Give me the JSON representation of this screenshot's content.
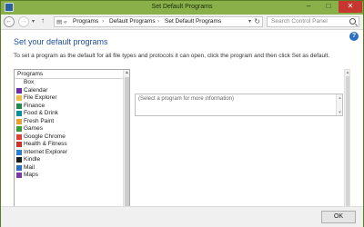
{
  "window": {
    "title": "Set Default Programs",
    "accent": "#8ab04a",
    "close_color": "#c7372f"
  },
  "window_buttons": {
    "minimize": "–",
    "maximize": "□",
    "close": "✕"
  },
  "nav": {
    "back_icon": "back-arrow-icon",
    "forward_icon": "forward-arrow-icon",
    "recent_icon": "chevron-down-icon",
    "up_icon": "up-arrow-icon",
    "breadcrumbs": [
      "Programs",
      "Default Programs",
      "Set Default Programs"
    ],
    "search_placeholder": "Search Control Panel"
  },
  "main": {
    "heading": "Set your default programs",
    "description": "To set a program as the default for all file types and protocols it can open, click the program and then click Set as default.",
    "list_header": "Programs",
    "programs": [
      {
        "label": "Box",
        "color": "#ffffff"
      },
      {
        "label": "Calendar",
        "color": "#6b2fa0"
      },
      {
        "label": "File Explorer",
        "color": "#e9c14c"
      },
      {
        "label": "Finance",
        "color": "#1f8a4c"
      },
      {
        "label": "Food & Drink",
        "color": "#0a8ea0"
      },
      {
        "label": "Fresh Paint",
        "color": "#e8a030"
      },
      {
        "label": "Games",
        "color": "#3a9a3a"
      },
      {
        "label": "Google Chrome",
        "color": "#d9443a"
      },
      {
        "label": "Health & Fitness",
        "color": "#c8342a"
      },
      {
        "label": "Internet Explorer",
        "color": "#2a7fd0"
      },
      {
        "label": "Kindle",
        "color": "#1a1a1a"
      },
      {
        "label": "Mail",
        "color": "#2a6fbf"
      },
      {
        "label": "Maps",
        "color": "#7a3aa0"
      }
    ],
    "info_placeholder": "(Select a program for more information)"
  },
  "footer": {
    "ok_label": "OK"
  }
}
